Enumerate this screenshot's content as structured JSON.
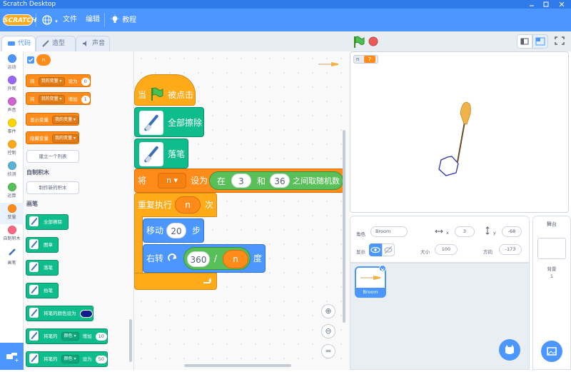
{
  "window": {
    "title": "Scratch Desktop"
  },
  "menu": {
    "logo": "SCRATCH",
    "file": "文件",
    "edit": "编辑",
    "tutorials": "教程"
  },
  "tabs": {
    "code": "代码",
    "costumes": "造型",
    "sounds": "声音"
  },
  "categories": [
    {
      "label": "运动",
      "color": "#4c97ff"
    },
    {
      "label": "外观",
      "color": "#9966ff"
    },
    {
      "label": "声音",
      "color": "#cf63cf"
    },
    {
      "label": "事件",
      "color": "#ffd500"
    },
    {
      "label": "控制",
      "color": "#ffab19"
    },
    {
      "label": "侦测",
      "color": "#5cb1d6"
    },
    {
      "label": "运算",
      "color": "#59c059"
    },
    {
      "label": "变量",
      "color": "#ff8c1a"
    },
    {
      "label": "自制积木",
      "color": "#ff6680"
    },
    {
      "label": "画笔",
      "color": "#0fbd8c"
    }
  ],
  "palette": {
    "var_reporter": "n",
    "set_var": {
      "prefix": "将",
      "var": "我的变量 ▾",
      "mid": "设为",
      "value": "0"
    },
    "change_var": {
      "prefix": "将",
      "var": "我的变量 ▾",
      "mid": "增加",
      "value": "1"
    },
    "show_var": {
      "prefix": "显示变量",
      "var": "我的变量 ▾"
    },
    "hide_var": {
      "prefix": "隐藏变量",
      "var": "我的变量 ▾"
    },
    "make_list": "建立一个列表",
    "my_blocks_heading": "自制积木",
    "make_block": "制作新的积木",
    "pen_heading": "画笔",
    "pen_blocks": [
      "全部擦除",
      "图章",
      "落笔",
      "抬笔"
    ],
    "set_pen_color": "将笔的颜色设为",
    "change_pen": {
      "prefix": "将笔的",
      "param": "颜色 ▾",
      "mid": "增加",
      "value": "10"
    },
    "set_pen": {
      "prefix": "将笔的",
      "param": "颜色 ▾",
      "mid": "设为",
      "value": "50"
    }
  },
  "script": {
    "hat": {
      "when": "当",
      "clicked": "被点击"
    },
    "erase_all": "全部擦除",
    "pen_down": "落笔",
    "set_var": {
      "prefix": "将",
      "var": "n ▾",
      "mid": "设为",
      "rand_prefix": "在",
      "rand_from": "3",
      "rand_and": "和",
      "rand_to": "36",
      "rand_suffix": "之间取随机数"
    },
    "repeat": {
      "prefix": "重复执行",
      "times": "n",
      "suffix": "次"
    },
    "move": {
      "prefix": "移动",
      "steps": "20",
      "suffix": "步"
    },
    "turn": {
      "prefix": "右转",
      "num": "360",
      "div": "/",
      "den": "n",
      "suffix": "度"
    }
  },
  "stage": {
    "monitor_label": "n",
    "monitor_value": "7"
  },
  "sprite_info": {
    "sprite_label": "角色",
    "sprite_name": "Broom",
    "x_label": "x",
    "x": "3",
    "y_label": "y",
    "y": "-68",
    "show_label": "显示",
    "size_label": "大小",
    "size": "100",
    "direction_label": "方向",
    "direction": "-173"
  },
  "sprite_list": [
    {
      "name": "Broom"
    }
  ],
  "stage_panel": {
    "title": "舞台",
    "backdrops_label": "背景",
    "backdrops_count": "1"
  },
  "colors": {
    "accent": "#4c97ff",
    "orange": "#ffab19",
    "variables": "#ff8c1a",
    "pen": "#0fbd8c",
    "pen_color_swatch": "#0e1c8c"
  }
}
